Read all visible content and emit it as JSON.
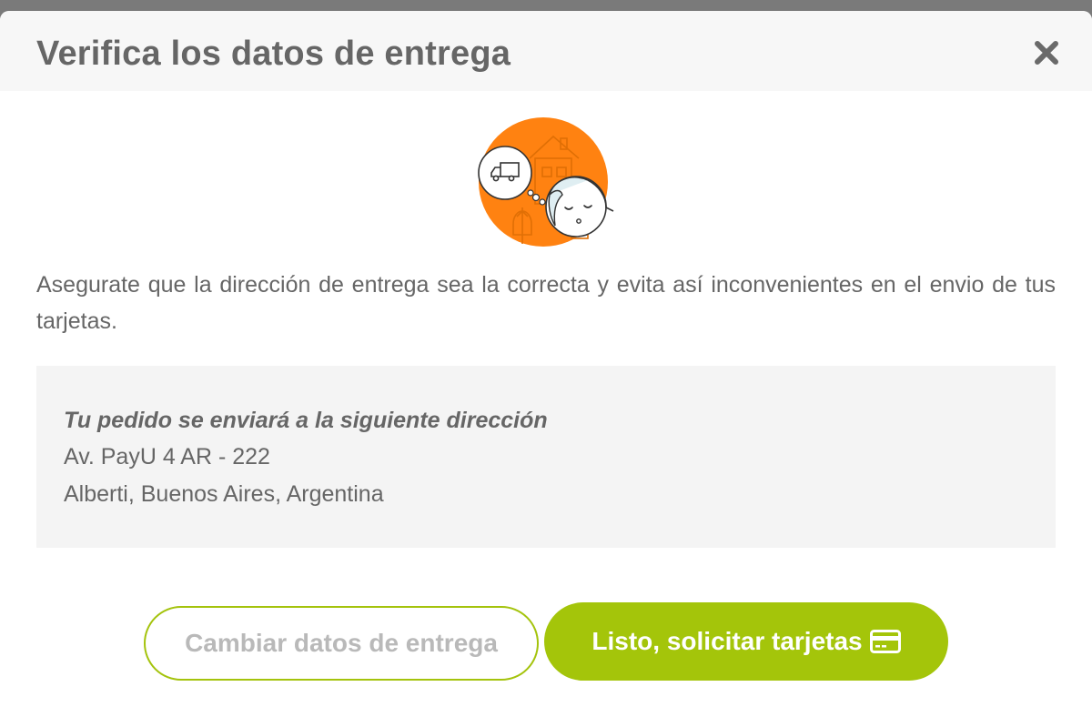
{
  "modal": {
    "title": "Verifica los datos de entrega",
    "close_icon": "close-icon"
  },
  "illustration": {
    "icon": "delivery-truck-face-illustration",
    "accent_color": "#ff8211"
  },
  "description": "Asegurate que la dirección de entrega sea la correcta y evita así inconvenientes en el envio de tus tarjetas.",
  "address": {
    "heading": "Tu pedido se enviará a la siguiente dirección",
    "line1": "Av. PayU 4 AR - 222",
    "line2": "Alberti, Buenos Aires, Argentina"
  },
  "buttons": {
    "change_label": "Cambiar datos de entrega",
    "confirm_label": "Listo, solicitar tarjetas",
    "confirm_icon": "credit-card-icon",
    "accent_color": "#a4c50a"
  }
}
